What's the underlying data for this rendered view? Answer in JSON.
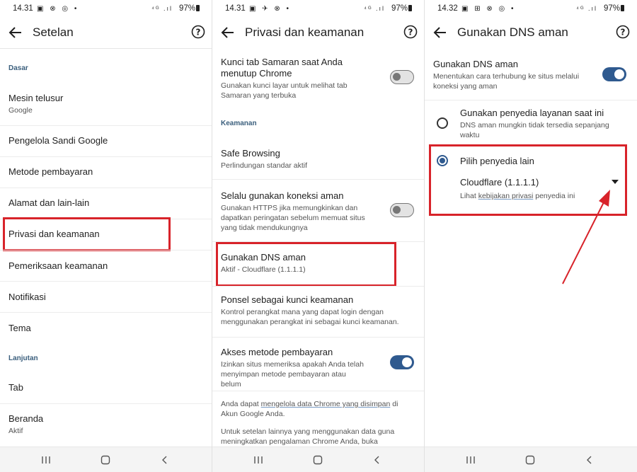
{
  "panel1": {
    "status": {
      "time": "14.31",
      "icons": "▣ ⊗ ◎ •",
      "net": "⁴ᴳ .ıl",
      "battery": "97%"
    },
    "title": "Setelan",
    "section_basic": "Dasar",
    "items": [
      {
        "title": "Mesin telusur",
        "subtitle": "Google"
      },
      {
        "title": "Pengelola Sandi Google"
      },
      {
        "title": "Metode pembayaran"
      },
      {
        "title": "Alamat dan lain-lain"
      },
      {
        "title": "Privasi dan keamanan"
      },
      {
        "title": "Pemeriksaan keamanan"
      },
      {
        "title": "Notifikasi"
      },
      {
        "title": "Tema"
      }
    ],
    "section_advanced": "Lanjutan",
    "adv_items": [
      {
        "title": "Tab"
      },
      {
        "title": "Beranda",
        "subtitle": "Aktif"
      }
    ]
  },
  "panel2": {
    "status": {
      "time": "14.31",
      "icons": "▣ ✈ ⊗ •",
      "net": "⁴ᴳ .ıl",
      "battery": "97%"
    },
    "title": "Privasi dan keamanan",
    "lock_tab": {
      "title": "Kunci tab Samaran saat Anda menutup Chrome",
      "subtitle": "Gunakan kunci layar untuk melihat tab Samaran yang terbuka",
      "toggle_on": false
    },
    "section_security": "Keamanan",
    "safe_browsing": {
      "title": "Safe Browsing",
      "subtitle": "Perlindungan standar aktif"
    },
    "secure_conn": {
      "title": "Selalu gunakan koneksi aman",
      "subtitle": "Gunakan HTTPS jika memungkinkan dan dapatkan peringatan sebelum memuat situs yang tidak mendukungnya",
      "toggle_on": false
    },
    "secure_dns": {
      "title": "Gunakan DNS aman",
      "subtitle": "Aktif - Cloudflare (1.1.1.1)"
    },
    "phone_key": {
      "title": "Ponsel sebagai kunci keamanan",
      "subtitle": "Kontrol perangkat mana yang dapat login dengan menggunakan perangkat ini sebagai kunci keamanan."
    },
    "payment": {
      "title": "Akses metode pembayaran",
      "subtitle": "Izinkan situs memeriksa apakah Anda telah menyimpan metode pembayaran atau belum",
      "toggle_on": true
    },
    "footer1_pre": "Anda dapat ",
    "footer1_link": "mengelola data Chrome yang disimpan",
    "footer1_post": " di Akun Google Anda.",
    "footer2": "Untuk setelan lainnya yang menggunakan data guna meningkatkan pengalaman Chrome Anda, buka"
  },
  "panel3": {
    "status": {
      "time": "14.32",
      "icons": "▣ ⊞ ⊗ ◎ •",
      "net": "⁴ᴳ .ıl",
      "battery": "97%"
    },
    "title": "Gunakan DNS aman",
    "main": {
      "title": "Gunakan DNS aman",
      "subtitle": "Menentukan cara terhubung ke situs melalui koneksi yang aman",
      "toggle_on": true
    },
    "option_current": {
      "title": "Gunakan penyedia layanan saat ini",
      "subtitle": "DNS aman mungkin tidak tersedia sepanjang waktu",
      "selected": false
    },
    "option_other": {
      "title": "Pilih penyedia lain",
      "selected": true
    },
    "provider": "Cloudflare (1.1.1.1)",
    "policy_pre": "Lihat ",
    "policy_link": "kebijakan privasi",
    "policy_post": " penyedia ini"
  },
  "colors": {
    "accent": "#2f5a8f",
    "highlight": "#d8232a",
    "section": "#3b5f7d"
  }
}
